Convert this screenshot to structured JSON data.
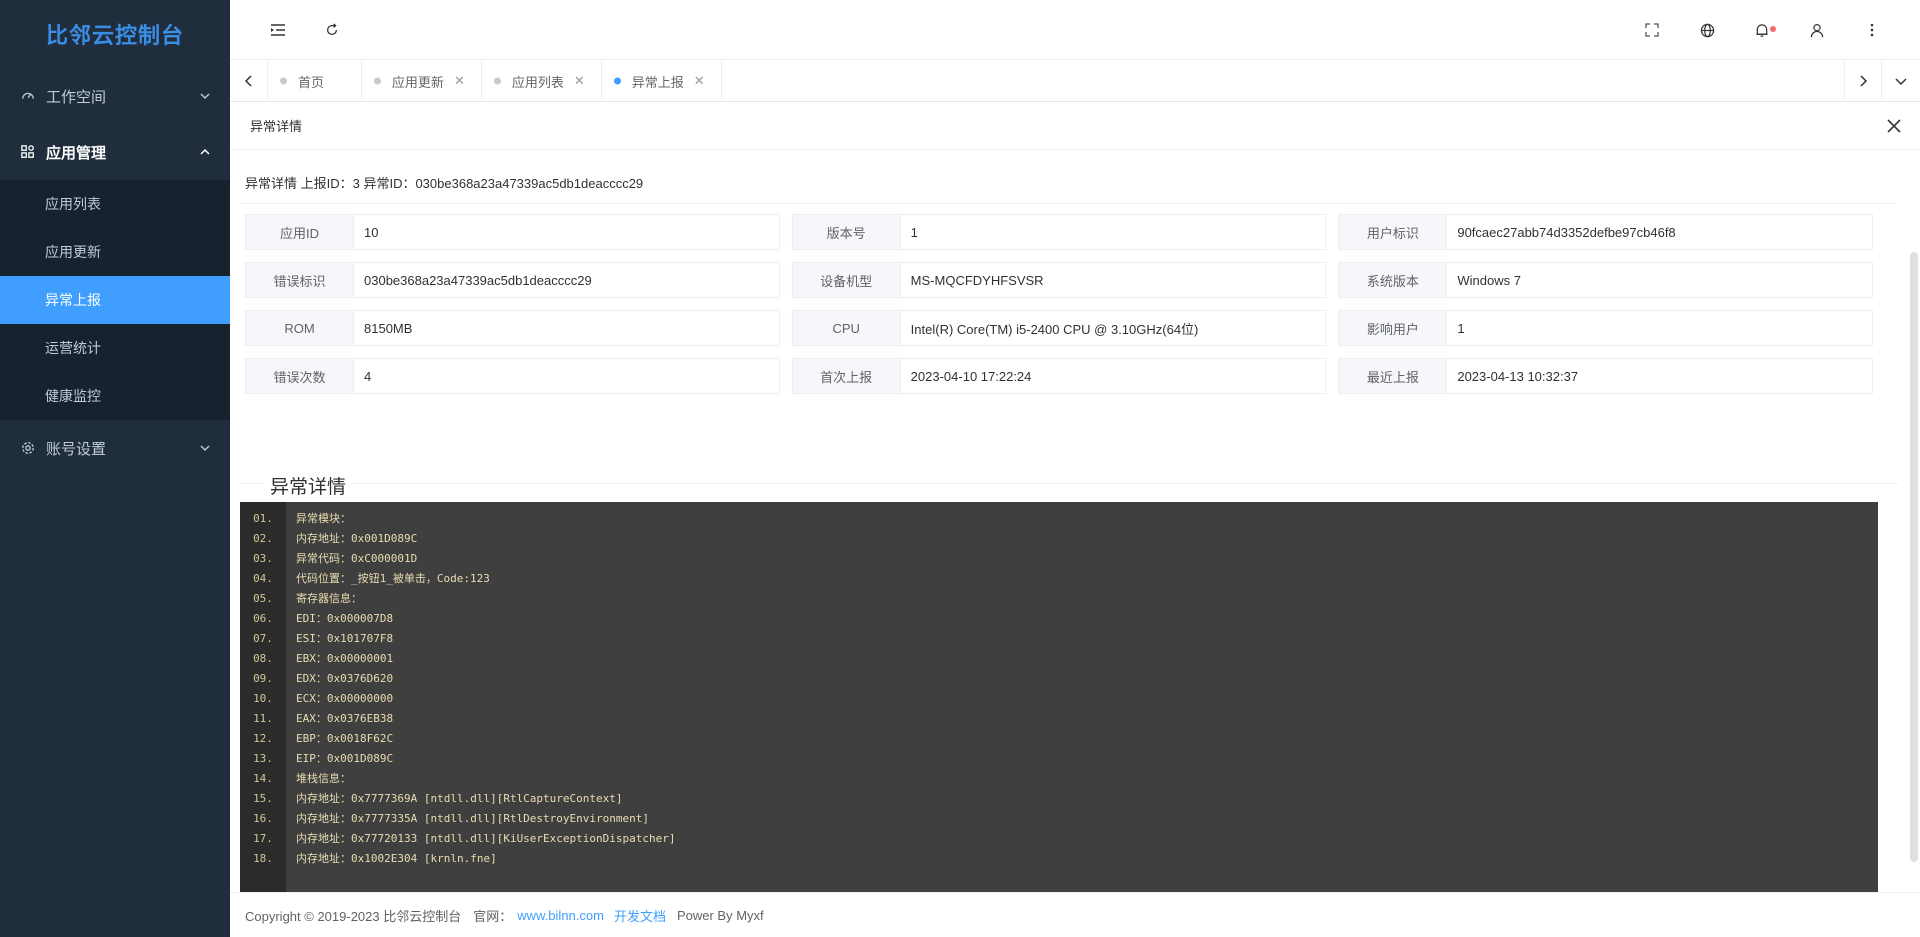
{
  "brand": "比邻云控制台",
  "sidebar": {
    "groups": [
      {
        "label": "工作空间",
        "icon": "dashboard-icon",
        "open": false
      },
      {
        "label": "应用管理",
        "icon": "apps-icon",
        "open": true
      },
      {
        "label": "账号设置",
        "icon": "gear-icon",
        "open": false
      }
    ],
    "sub_items": [
      {
        "label": "应用列表",
        "active": false
      },
      {
        "label": "应用更新",
        "active": false
      },
      {
        "label": "异常上报",
        "active": true
      },
      {
        "label": "运营统计",
        "active": false
      },
      {
        "label": "健康监控",
        "active": false
      }
    ]
  },
  "topbar": {
    "icons": [
      "menu-fold-icon",
      "refresh-icon",
      "fullscreen-icon",
      "language-icon",
      "bell-icon",
      "user-icon",
      "more-icon"
    ]
  },
  "tabs": [
    {
      "label": "首页",
      "closable": false,
      "active": false
    },
    {
      "label": "应用更新",
      "closable": true,
      "active": false
    },
    {
      "label": "应用列表",
      "closable": true,
      "active": false
    },
    {
      "label": "异常上报",
      "closable": true,
      "active": true
    }
  ],
  "dialog": {
    "title": "异常详情",
    "header_line": "异常详情 上报ID：3 异常ID：030be368a23a47339ac5db1deacccc29"
  },
  "info": [
    [
      {
        "k": "应用ID",
        "v": "10"
      },
      {
        "k": "版本号",
        "v": "1"
      },
      {
        "k": "用户标识",
        "v": "90fcaec27abb74d3352defbe97cb46f8"
      }
    ],
    [
      {
        "k": "错误标识",
        "v": "030be368a23a47339ac5db1deacccc29"
      },
      {
        "k": "设备机型",
        "v": "MS-MQCFDYHFSVSR"
      },
      {
        "k": "系统版本",
        "v": "Windows 7"
      }
    ],
    [
      {
        "k": "ROM",
        "v": "8150MB"
      },
      {
        "k": "CPU",
        "v": "Intel(R) Core(TM) i5-2400 CPU @ 3.10GHz(64位)"
      },
      {
        "k": "影响用户",
        "v": "1"
      }
    ],
    [
      {
        "k": "错误次数",
        "v": "4"
      },
      {
        "k": "首次上报",
        "v": "2023-04-10 17:22:24"
      },
      {
        "k": "最近上报",
        "v": "2023-04-13 10:32:37"
      }
    ]
  ],
  "section_title": "异常详情",
  "code_lines": [
    {
      "num": "01.",
      "text": "异常模块："
    },
    {
      "num": "02.",
      "text": "内存地址：0x001D089C"
    },
    {
      "num": "03.",
      "text": "异常代码：0xC000001D"
    },
    {
      "num": "04.",
      "text": "代码位置：_按钮1_被单击，Code:123"
    },
    {
      "num": "05.",
      "text": "寄存器信息："
    },
    {
      "num": "06.",
      "text": "EDI：0x000007D8"
    },
    {
      "num": "07.",
      "text": "ESI：0x101707F8"
    },
    {
      "num": "08.",
      "text": "EBX：0x00000001"
    },
    {
      "num": "09.",
      "text": "EDX：0x0376D620"
    },
    {
      "num": "10.",
      "text": "ECX：0x00000000"
    },
    {
      "num": "11.",
      "text": "EAX：0x0376EB38"
    },
    {
      "num": "12.",
      "text": "EBP：0x0018F62C"
    },
    {
      "num": "13.",
      "text": "EIP：0x001D089C"
    },
    {
      "num": "14.",
      "text": "堆栈信息："
    },
    {
      "num": "15.",
      "text": "内存地址：0x7777369A [ntdll.dll][RtlCaptureContext]"
    },
    {
      "num": "16.",
      "text": "内存地址：0x7777335A [ntdll.dll][RtlDestroyEnvironment]"
    },
    {
      "num": "17.",
      "text": "内存地址：0x77720133 [ntdll.dll][KiUserExceptionDispatcher]"
    },
    {
      "num": "18.",
      "text": "内存地址：0x1002E304 [krnln.fne]"
    }
  ],
  "footer": {
    "copyright": "Copyright © 2019-2023 比邻云控制台",
    "site_label": "官网：",
    "site_link": "www.bilnn.com",
    "docs_link": "开发文档",
    "power": "Power By Myxf"
  },
  "colors": {
    "sidebar_bg": "#1f2d3d",
    "accent": "#409eff",
    "brand": "#3a8ee6",
    "code_bg": "#3f3f3f"
  }
}
